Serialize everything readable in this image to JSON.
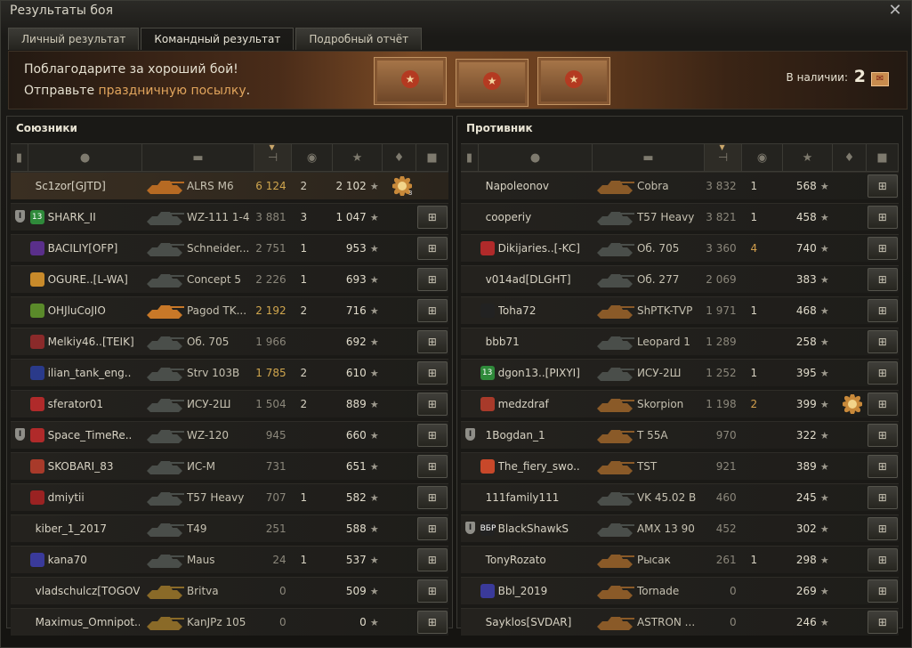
{
  "window": {
    "title": "Результаты боя",
    "close_label": "✕"
  },
  "tabs": [
    {
      "label": "Личный результат",
      "active": false
    },
    {
      "label": "Командный результат",
      "active": true
    },
    {
      "label": "Подробный отчёт",
      "active": false
    }
  ],
  "banner": {
    "line1": "Поблагодарите за хороший бой!",
    "line2_prefix": "Отправьте ",
    "line2_link": "праздничную посылку",
    "line2_suffix": ".",
    "available_label": "В наличии:",
    "available_count": "2"
  },
  "allies": {
    "title": "Союзники",
    "players": [
      {
        "squad": "",
        "clan": "",
        "clan_color": "",
        "name": "Sc1zor[GJTD]",
        "tank": "ALRS M6",
        "tank_color": "#b66a23",
        "damage": "6 124",
        "dmg_hi": true,
        "frags": "2",
        "frags_hi": false,
        "xp": "2 102",
        "medal": "3",
        "gift": false,
        "me": true
      },
      {
        "squad": "I",
        "clan": "13",
        "clan_color": "#2f8a3a",
        "name": "SHARK_II",
        "tank": "WZ-111 1-4",
        "tank_color": "#4a4e4a",
        "damage": "3 881",
        "dmg_hi": false,
        "frags": "3",
        "frags_hi": false,
        "xp": "1 047",
        "medal": "",
        "gift": true,
        "me": false
      },
      {
        "squad": "",
        "clan": "",
        "clan_color": "#5a2f8a",
        "name": "BACILIY[OFP]",
        "tank": "Schneider...",
        "tank_color": "#4a4e4a",
        "damage": "2 751",
        "dmg_hi": false,
        "frags": "1",
        "frags_hi": false,
        "xp": "953",
        "medal": "",
        "gift": true,
        "me": false
      },
      {
        "squad": "",
        "clan": "",
        "clan_color": "#c88a2a",
        "name": "OGURE..[L-WA]",
        "tank": "Concept 5",
        "tank_color": "#4a4e4a",
        "damage": "2 226",
        "dmg_hi": false,
        "frags": "1",
        "frags_hi": false,
        "xp": "693",
        "medal": "",
        "gift": true,
        "me": false
      },
      {
        "squad": "",
        "clan": "",
        "clan_color": "#5a8a2a",
        "name": "OHJluCoJIO",
        "tank": "Pagod TK...",
        "tank_color": "#c87828",
        "damage": "2 192",
        "dmg_hi": true,
        "frags": "2",
        "frags_hi": false,
        "xp": "716",
        "medal": "",
        "gift": true,
        "me": false
      },
      {
        "squad": "",
        "clan": "",
        "clan_color": "#8a2a2a",
        "name": "Melkiy46..[TEIK]",
        "tank": "Об. 705",
        "tank_color": "#4a4e4a",
        "damage": "1 966",
        "dmg_hi": false,
        "frags": "",
        "frags_hi": false,
        "xp": "692",
        "medal": "",
        "gift": true,
        "me": false
      },
      {
        "squad": "",
        "clan": "",
        "clan_color": "#2a3a8a",
        "name": "ilian_tank_eng..",
        "tank": "Strv 103B",
        "tank_color": "#4a4e4a",
        "damage": "1 785",
        "dmg_hi": true,
        "frags": "2",
        "frags_hi": false,
        "xp": "610",
        "medal": "",
        "gift": true,
        "me": false
      },
      {
        "squad": "",
        "clan": "",
        "clan_color": "#b02a2a",
        "name": "sferator01",
        "tank": "ИСУ-2Ш",
        "tank_color": "#4a4e4a",
        "damage": "1 504",
        "dmg_hi": false,
        "frags": "2",
        "frags_hi": false,
        "xp": "889",
        "medal": "",
        "gift": true,
        "me": false
      },
      {
        "squad": "I",
        "clan": "",
        "clan_color": "#b02a2a",
        "name": "Space_TimeRe..",
        "tank": "WZ-120",
        "tank_color": "#4a4e4a",
        "damage": "945",
        "dmg_hi": false,
        "frags": "",
        "frags_hi": false,
        "xp": "660",
        "medal": "",
        "gift": true,
        "me": false
      },
      {
        "squad": "",
        "clan": "",
        "clan_color": "#a83a2a",
        "name": "SKOBARI_83",
        "tank": "ИС-М",
        "tank_color": "#4a4e4a",
        "damage": "731",
        "dmg_hi": false,
        "frags": "",
        "frags_hi": false,
        "xp": "651",
        "medal": "",
        "gift": true,
        "me": false
      },
      {
        "squad": "",
        "clan": "",
        "clan_color": "#9a2222",
        "name": "dmiytii",
        "tank": "T57 Heavy",
        "tank_color": "#4a4e4a",
        "damage": "707",
        "dmg_hi": false,
        "frags": "1",
        "frags_hi": false,
        "xp": "582",
        "medal": "",
        "gift": true,
        "me": false
      },
      {
        "squad": "",
        "clan": "",
        "clan_color": "",
        "name": "kiber_1_2017",
        "tank": "T49",
        "tank_color": "#4a4e4a",
        "damage": "251",
        "dmg_hi": false,
        "frags": "",
        "frags_hi": false,
        "xp": "588",
        "medal": "",
        "gift": true,
        "me": false
      },
      {
        "squad": "",
        "clan": "",
        "clan_color": "#3a3a9a",
        "name": "kana70",
        "tank": "Maus",
        "tank_color": "#4a4e4a",
        "damage": "24",
        "dmg_hi": false,
        "frags": "1",
        "frags_hi": false,
        "xp": "537",
        "medal": "",
        "gift": true,
        "me": false
      },
      {
        "squad": "",
        "clan": "",
        "clan_color": "",
        "name": "vladschulcz[TOGOV]",
        "tank": "Britva",
        "tank_color": "#8a6a28",
        "damage": "0",
        "dmg_hi": false,
        "frags": "",
        "frags_hi": false,
        "xp": "509",
        "medal": "",
        "gift": true,
        "me": false
      },
      {
        "squad": "",
        "clan": "",
        "clan_color": "",
        "name": "Maximus_Omnipot..",
        "tank": "KanJPz 105",
        "tank_color": "#8a6a28",
        "damage": "0",
        "dmg_hi": false,
        "frags": "",
        "frags_hi": false,
        "xp": "0",
        "medal": "",
        "gift": true,
        "me": false
      }
    ]
  },
  "enemies": {
    "title": "Противник",
    "players": [
      {
        "squad": "",
        "clan": "",
        "clan_color": "",
        "name": "Napoleonov",
        "tank": "Cobra",
        "tank_color": "#8a5a28",
        "damage": "3 832",
        "dmg_hi": false,
        "frags": "1",
        "frags_hi": false,
        "xp": "568",
        "medal": "",
        "gift": true,
        "me": false
      },
      {
        "squad": "",
        "clan": "",
        "clan_color": "",
        "name": "cooperiy",
        "tank": "T57 Heavy",
        "tank_color": "#4a4e4a",
        "damage": "3 821",
        "dmg_hi": false,
        "frags": "1",
        "frags_hi": false,
        "xp": "458",
        "medal": "",
        "gift": true,
        "me": false
      },
      {
        "squad": "",
        "clan": "",
        "clan_color": "#b02a2a",
        "name": "Dikijaries..[-KC]",
        "tank": "Об. 705",
        "tank_color": "#4a4e4a",
        "damage": "3 360",
        "dmg_hi": false,
        "frags": "4",
        "frags_hi": true,
        "xp": "740",
        "medal": "",
        "gift": true,
        "me": false
      },
      {
        "squad": "",
        "clan": "",
        "clan_color": "",
        "name": "v014ad[DLGHT]",
        "tank": "Об. 277",
        "tank_color": "#4a4e4a",
        "damage": "2 069",
        "dmg_hi": false,
        "frags": "",
        "frags_hi": false,
        "xp": "383",
        "medal": "",
        "gift": true,
        "me": false
      },
      {
        "squad": "",
        "clan": "",
        "clan_color": "#222222",
        "name": "Toha72",
        "tank": "ShPTK-TVP",
        "tank_color": "#8a5a28",
        "damage": "1 971",
        "dmg_hi": false,
        "frags": "1",
        "frags_hi": false,
        "xp": "468",
        "medal": "",
        "gift": true,
        "me": false
      },
      {
        "squad": "",
        "clan": "",
        "clan_color": "",
        "name": "bbb71",
        "tank": "Leopard 1",
        "tank_color": "#4a4e4a",
        "damage": "1 289",
        "dmg_hi": false,
        "frags": "",
        "frags_hi": false,
        "xp": "258",
        "medal": "",
        "gift": true,
        "me": false
      },
      {
        "squad": "",
        "clan": "13",
        "clan_color": "#2f8a3a",
        "name": "dgon13..[PIXYI]",
        "tank": "ИСУ-2Ш",
        "tank_color": "#4a4e4a",
        "damage": "1 252",
        "dmg_hi": false,
        "frags": "1",
        "frags_hi": false,
        "xp": "395",
        "medal": "",
        "gift": true,
        "me": false
      },
      {
        "squad": "",
        "clan": "",
        "clan_color": "#a83a2a",
        "name": "medzdraf",
        "tank": "Skorpion",
        "tank_color": "#8a5a28",
        "damage": "1 198",
        "dmg_hi": false,
        "frags": "2",
        "frags_hi": true,
        "xp": "399",
        "medal": "flower",
        "gift": true,
        "me": false
      },
      {
        "squad": "I",
        "clan": "",
        "clan_color": "",
        "name": "1Bogdan_1",
        "tank": "T 55A",
        "tank_color": "#8a5a28",
        "damage": "970",
        "dmg_hi": false,
        "frags": "",
        "frags_hi": false,
        "xp": "322",
        "medal": "",
        "gift": true,
        "me": false
      },
      {
        "squad": "",
        "clan": "",
        "clan_color": "#c8482a",
        "name": "The_fiery_swo..",
        "tank": "TST",
        "tank_color": "#8a5a28",
        "damage": "921",
        "dmg_hi": false,
        "frags": "",
        "frags_hi": false,
        "xp": "389",
        "medal": "",
        "gift": true,
        "me": false
      },
      {
        "squad": "",
        "clan": "",
        "clan_color": "",
        "name": "111family111",
        "tank": "VK 45.02 B",
        "tank_color": "#4a4e4a",
        "damage": "460",
        "dmg_hi": false,
        "frags": "",
        "frags_hi": false,
        "xp": "245",
        "medal": "",
        "gift": true,
        "me": false
      },
      {
        "squad": "I",
        "clan": "ВБР",
        "clan_color": "#222222",
        "name": "BlackShawkS",
        "tank": "AMX 13 90",
        "tank_color": "#4a4e4a",
        "damage": "452",
        "dmg_hi": false,
        "frags": "",
        "frags_hi": false,
        "xp": "302",
        "medal": "",
        "gift": true,
        "me": false
      },
      {
        "squad": "",
        "clan": "",
        "clan_color": "",
        "name": "TonyRozato",
        "tank": "Рысак",
        "tank_color": "#8a5a28",
        "damage": "261",
        "dmg_hi": false,
        "frags": "1",
        "frags_hi": false,
        "xp": "298",
        "medal": "",
        "gift": true,
        "me": false
      },
      {
        "squad": "",
        "clan": "",
        "clan_color": "#3a3a9a",
        "name": "Bbl_2019",
        "tank": "Tornade",
        "tank_color": "#8a5a28",
        "damage": "0",
        "dmg_hi": false,
        "frags": "",
        "frags_hi": false,
        "xp": "269",
        "medal": "",
        "gift": true,
        "me": false
      },
      {
        "squad": "",
        "clan": "",
        "clan_color": "",
        "name": "Sayklos[SVDAR]",
        "tank": "ASTRON ...",
        "tank_color": "#8a5a28",
        "damage": "0",
        "dmg_hi": false,
        "frags": "",
        "frags_hi": false,
        "xp": "246",
        "medal": "",
        "gift": true,
        "me": false
      }
    ]
  }
}
